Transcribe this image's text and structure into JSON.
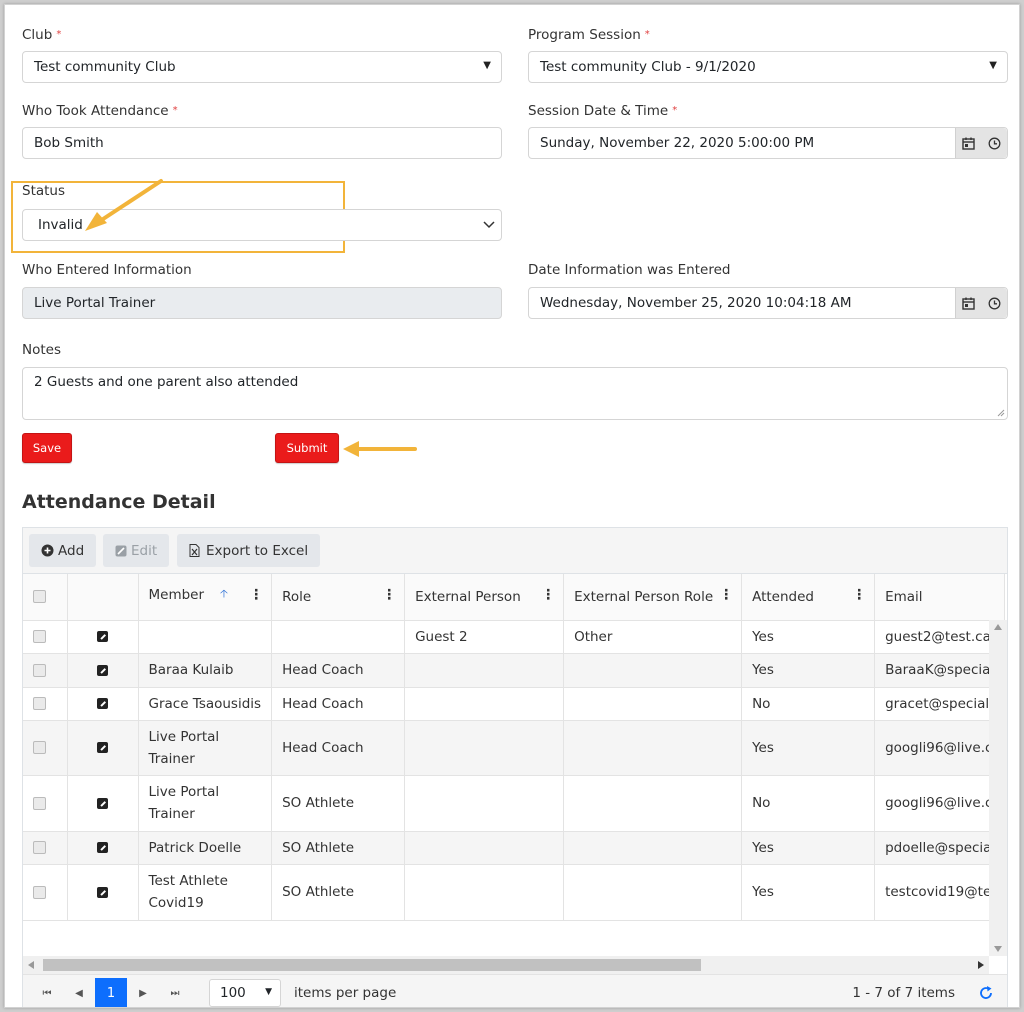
{
  "form": {
    "club_label": "Club",
    "club_value": "Test community Club",
    "program_session_label": "Program Session",
    "program_session_value": "Test community Club - 9/1/2020",
    "who_took_label": "Who Took Attendance",
    "who_took_value": "Bob Smith",
    "session_date_label": "Session Date & Time",
    "session_date_value": "Sunday, November 22, 2020 5:00:00 PM",
    "status_label": "Status",
    "status_value": "Invalid",
    "who_entered_label": "Who Entered Information",
    "who_entered_value": "Live Portal Trainer",
    "date_entered_label": "Date Information was Entered",
    "date_entered_value": "Wednesday, November 25, 2020 10:04:18 AM",
    "notes_label": "Notes",
    "notes_value": "2 Guests and one parent also attended",
    "required_marker": "*"
  },
  "actions": {
    "save_label": "Save",
    "submit_label": "Submit"
  },
  "attendance": {
    "title": "Attendance Detail",
    "toolbar": {
      "add_label": "Add",
      "edit_label": "Edit",
      "export_label": "Export to Excel"
    },
    "columns": [
      "Member",
      "Role",
      "External Person",
      "External Person Role",
      "Attended",
      "Email"
    ],
    "rows": [
      {
        "member": "",
        "role": "",
        "external_person": "Guest 2",
        "external_role": "Other",
        "attended": "Yes",
        "email": "guest2@test.ca"
      },
      {
        "member": "Baraa Kulaib",
        "role": "Head Coach",
        "external_person": "",
        "external_role": "",
        "attended": "Yes",
        "email": "BaraaK@special"
      },
      {
        "member": "Grace Tsaousidis",
        "role": "Head Coach",
        "external_person": "",
        "external_role": "",
        "attended": "No",
        "email": "gracet@special"
      },
      {
        "member": "Live Portal Trainer",
        "role": "Head Coach",
        "external_person": "",
        "external_role": "",
        "attended": "Yes",
        "email": "googli96@live.c"
      },
      {
        "member": "Live Portal Trainer",
        "role": "SO Athlete",
        "external_person": "",
        "external_role": "",
        "attended": "No",
        "email": "googli96@live.c"
      },
      {
        "member": "Patrick Doelle",
        "role": "SO Athlete",
        "external_person": "",
        "external_role": "",
        "attended": "Yes",
        "email": "pdoelle@specia"
      },
      {
        "member": "Test Athlete Covid19",
        "role": "SO Athlete",
        "external_person": "",
        "external_role": "",
        "attended": "Yes",
        "email": "testcovid19@te"
      }
    ],
    "pager": {
      "current_page": "1",
      "page_size": "100",
      "items_per_page_label": "items per page",
      "summary": "1 - 7 of 7 items"
    }
  },
  "colors": {
    "accent_red": "#ea1b1b",
    "annotation_orange": "#f2b43a",
    "pager_active": "#0d6efd"
  }
}
